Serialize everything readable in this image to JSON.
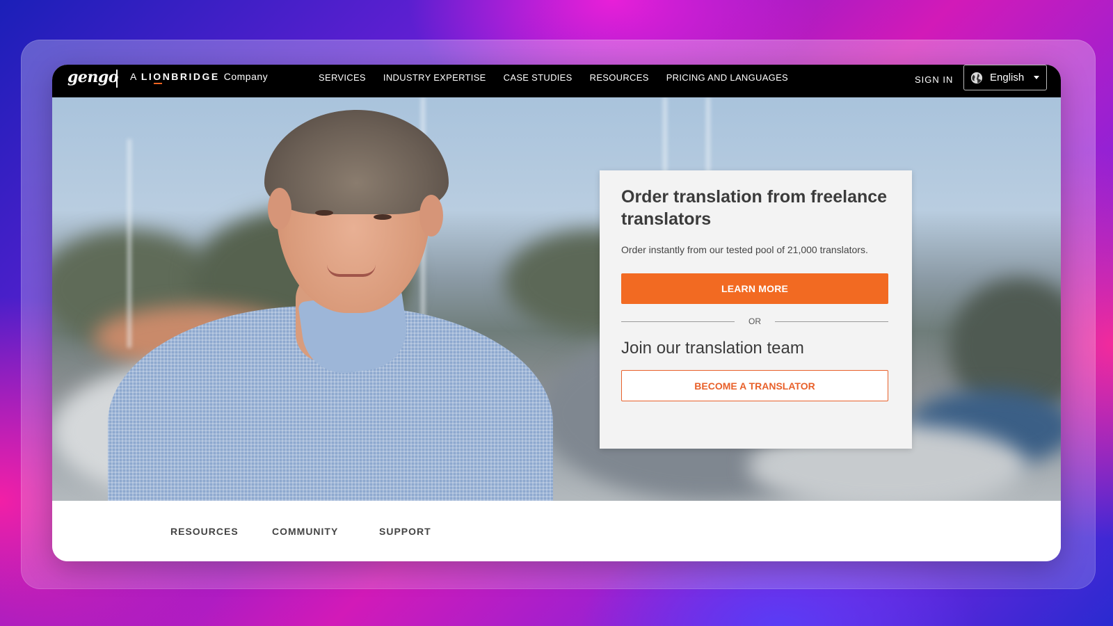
{
  "header": {
    "logo_text": "gengo",
    "company_prefix": "A",
    "company_brand_start": "LI",
    "company_brand_o": "O",
    "company_brand_end": "NBRIDGE",
    "company_suffix": "Company",
    "menu": [
      "SERVICES",
      "INDUSTRY EXPERTISE",
      "CASE STUDIES",
      "RESOURCES",
      "PRICING AND LANGUAGES"
    ],
    "sign_in": "SIGN IN",
    "language": "English"
  },
  "hero_card": {
    "title": "Order translation from freelance translators",
    "subtitle": "Order instantly from our tested pool of 21,000 translators.",
    "primary_button": "LEARN MORE",
    "divider_text": "OR",
    "join_title": "Join our translation team",
    "secondary_button": "BECOME A TRANSLATOR"
  },
  "footer_nav": [
    "RESOURCES",
    "COMMUNITY",
    "SUPPORT"
  ],
  "colors": {
    "accent": "#f26a22",
    "nav_background": "#000000",
    "card_background": "#f3f3f3"
  }
}
